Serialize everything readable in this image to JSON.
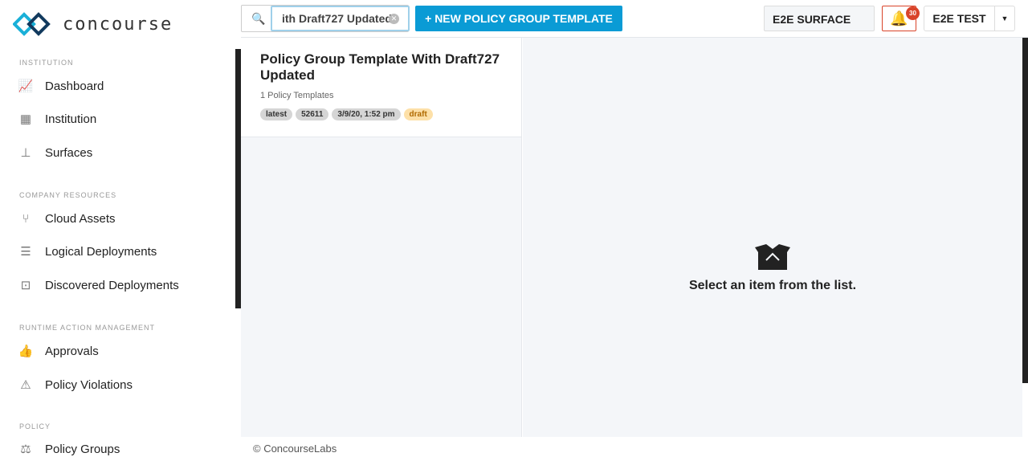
{
  "brand": "concourse",
  "sidebar": {
    "sections": [
      {
        "title": "INSTITUTION",
        "items": [
          {
            "label": "Dashboard",
            "icon": "chart-icon"
          },
          {
            "label": "Institution",
            "icon": "building-icon"
          },
          {
            "label": "Surfaces",
            "icon": "sitemap-icon"
          }
        ]
      },
      {
        "title": "COMPANY RESOURCES",
        "items": [
          {
            "label": "Cloud Assets",
            "icon": "branch-icon"
          },
          {
            "label": "Logical Deployments",
            "icon": "server-icon"
          },
          {
            "label": "Discovered Deployments",
            "icon": "discover-icon"
          }
        ]
      },
      {
        "title": "RUNTIME ACTION MANAGEMENT",
        "items": [
          {
            "label": "Approvals",
            "icon": "thumbs-up-icon"
          },
          {
            "label": "Policy Violations",
            "icon": "warning-icon"
          }
        ]
      },
      {
        "title": "POLICY",
        "items": [
          {
            "label": "Policy Groups",
            "icon": "balance-icon"
          }
        ]
      }
    ]
  },
  "topbar": {
    "search_value": "ith Draft727 Updated",
    "new_button": "+ NEW POLICY GROUP TEMPLATE",
    "surface": "E2E SURFACE",
    "notifications": "30",
    "user": "E2E TEST"
  },
  "list": {
    "items": [
      {
        "title": "Policy Group Template With Draft727 Updated",
        "subtitle": "1 Policy Templates",
        "tags": [
          "latest",
          "52611",
          "3/9/20, 1:52 pm",
          "draft"
        ]
      }
    ]
  },
  "detail": {
    "empty_text": "Select an item from the list."
  },
  "footer": "© ConcourseLabs",
  "colors": {
    "accent": "#0a9bd5",
    "alert": "#d9442a"
  }
}
